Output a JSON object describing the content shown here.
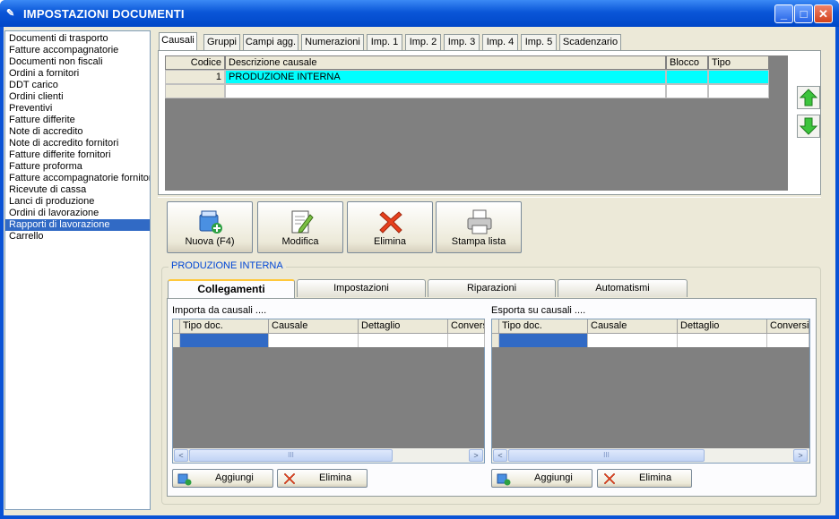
{
  "window": {
    "title": "IMPOSTAZIONI DOCUMENTI",
    "min": "_",
    "max": "□",
    "close": "✕"
  },
  "doc_list": [
    "Documenti di trasporto",
    "Fatture accompagnatorie",
    "Documenti non fiscali",
    "Ordini a fornitori",
    "DDT carico",
    "Ordini clienti",
    "Preventivi",
    "Fatture differite",
    "Note di accredito",
    "Note di accredito fornitori",
    "Fatture differite fornitori",
    "Fatture proforma",
    "Fatture accompagnatorie fornitori",
    "Ricevute di cassa",
    "Lanci di produzione",
    "Ordini di lavorazione",
    "Rapporti di lavorazione",
    "Carrello"
  ],
  "selected_doc": "Rapporti di lavorazione",
  "top_tabs": [
    "Causali",
    "Gruppi",
    "Campi agg.",
    "Numerazioni",
    "Imp. 1",
    "Imp. 2",
    "Imp. 3",
    "Imp. 4",
    "Imp. 5",
    "Scadenzario"
  ],
  "grid": {
    "headers": [
      "Codice",
      "Descrizione causale",
      "Blocco",
      "Tipo"
    ],
    "rows": [
      [
        "1",
        "PRODUZIONE INTERNA",
        "",
        ""
      ]
    ],
    "selected_color": "#00ffff"
  },
  "toolbar": {
    "new_label": "Nuova (F4)",
    "edit_label": "Modifica",
    "delete_label": "Elimina",
    "print_label": "Stampa lista"
  },
  "group_title": "PRODUZIONE INTERNA",
  "bottom_tabs": [
    "Collegamenti",
    "Impostazioni",
    "Riparazioni",
    "Automatismi"
  ],
  "import_section": {
    "label": "Importa da causali ....",
    "headers": [
      "Tipo doc.",
      "Causale",
      "Dettaglio",
      "Convers"
    ],
    "add_label": "Aggiungi",
    "delete_label": "Elimina"
  },
  "export_section": {
    "label": "Esporta su causali ....",
    "headers": [
      "Tipo doc.",
      "Causale",
      "Dettaglio",
      "Conversi"
    ],
    "add_label": "Aggiungi",
    "delete_label": "Elimina"
  },
  "scroll": {
    "left": "<",
    "right": ">",
    "grip": "III"
  },
  "colors": {
    "titlebar": "#0a56d8",
    "selection": "#316ac5",
    "group_title": "#0046d5"
  }
}
